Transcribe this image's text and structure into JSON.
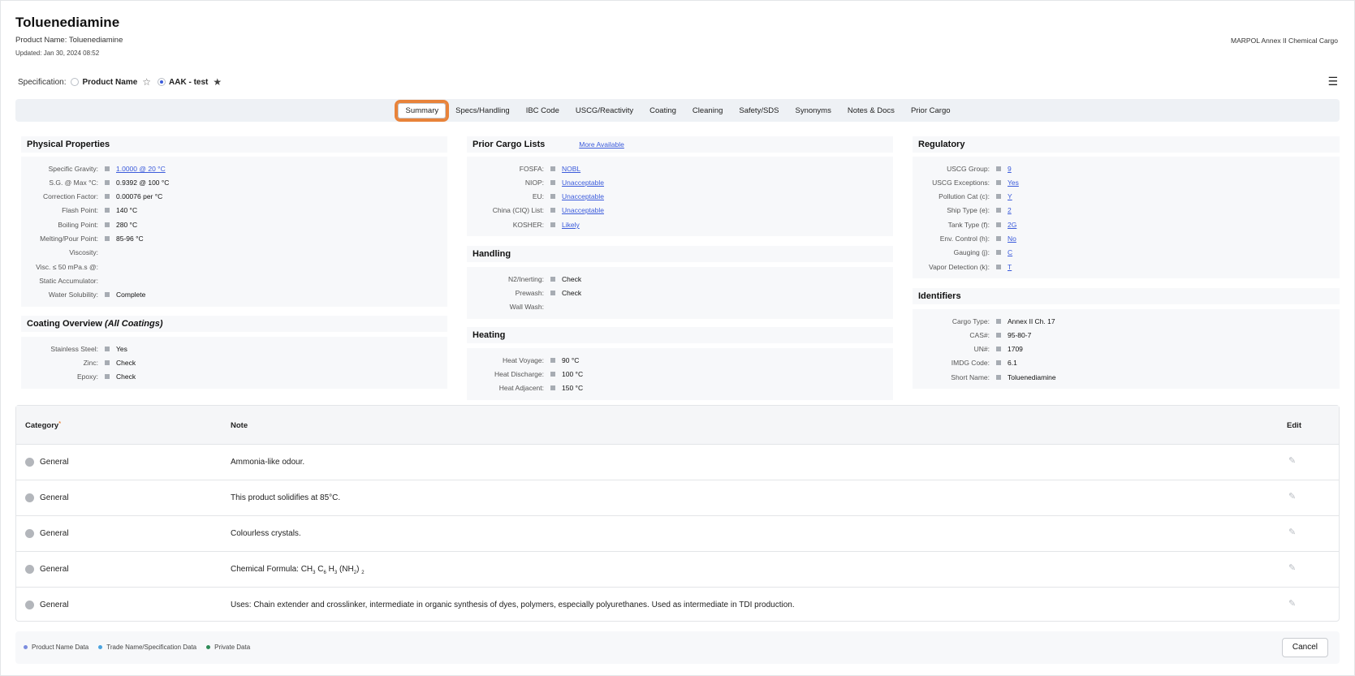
{
  "header": {
    "title": "Toluenediamine",
    "product_name": "Product Name: Toluenediamine",
    "updated": "Updated: Jan 30, 2024 08:52",
    "classification": "MARPOL Annex II Chemical Cargo"
  },
  "specification": {
    "label": "Specification:",
    "options": [
      {
        "label": "Product Name",
        "selected": false,
        "favorite": false
      },
      {
        "label": "AAK - test",
        "selected": true,
        "favorite": true
      }
    ]
  },
  "tabs": [
    {
      "label": "Summary",
      "active": true
    },
    {
      "label": "Specs/Handling"
    },
    {
      "label": "IBC Code"
    },
    {
      "label": "USCG/Reactivity"
    },
    {
      "label": "Coating"
    },
    {
      "label": "Cleaning"
    },
    {
      "label": "Safety/SDS"
    },
    {
      "label": "Synonyms"
    },
    {
      "label": "Notes & Docs"
    },
    {
      "label": "Prior Cargo"
    }
  ],
  "physical": {
    "title": "Physical Properties",
    "rows": [
      {
        "k": "Specific Gravity:",
        "v": "1.0000 @ 20 °C",
        "link": true
      },
      {
        "k": "S.G. @ Max °C:",
        "v": "0.9392 @ 100 °C"
      },
      {
        "k": "Correction Factor:",
        "v": "0.00076 per °C"
      },
      {
        "k": "Flash Point:",
        "v": "140 °C"
      },
      {
        "k": "Boiling Point:",
        "v": "280 °C"
      },
      {
        "k": "Melting/Pour Point:",
        "v": "85-96 °C"
      },
      {
        "k": "Viscosity:",
        "v": ""
      },
      {
        "k": "Visc. ≤ 50 mPa.s @:",
        "v": ""
      },
      {
        "k": "Static Accumulator:",
        "v": ""
      },
      {
        "k": "Water Solubility:",
        "v": "Complete"
      }
    ]
  },
  "coating": {
    "title": "Coating Overview",
    "title_suffix": "(All Coatings)",
    "rows": [
      {
        "k": "Stainless Steel:",
        "v": "Yes"
      },
      {
        "k": "Zinc:",
        "v": "Check"
      },
      {
        "k": "Epoxy:",
        "v": "Check"
      }
    ]
  },
  "prior_cargo": {
    "title": "Prior Cargo Lists",
    "more": "More Available",
    "rows": [
      {
        "k": "FOSFA:",
        "v": "NOBL",
        "link": true
      },
      {
        "k": "NIOP:",
        "v": "Unacceptable",
        "link": true
      },
      {
        "k": "EU:",
        "v": "Unacceptable",
        "link": true
      },
      {
        "k": "China (CIQ) List:",
        "v": "Unacceptable",
        "link": true
      },
      {
        "k": "KOSHER:",
        "v": "Likely",
        "link": true
      }
    ]
  },
  "handling": {
    "title": "Handling",
    "rows": [
      {
        "k": "N2/Inerting:",
        "v": "Check"
      },
      {
        "k": "Prewash:",
        "v": "Check"
      },
      {
        "k": "Wall Wash:",
        "v": ""
      }
    ]
  },
  "heating": {
    "title": "Heating",
    "rows": [
      {
        "k": "Heat Voyage:",
        "v": "90 °C"
      },
      {
        "k": "Heat Discharge:",
        "v": "100 °C"
      },
      {
        "k": "Heat Adjacent:",
        "v": "150 °C"
      }
    ]
  },
  "regulatory": {
    "title": "Regulatory",
    "rows": [
      {
        "k": "USCG Group:",
        "v": "9",
        "link": true
      },
      {
        "k": "USCG Exceptions:",
        "v": "Yes",
        "link": true
      },
      {
        "k": "Pollution Cat (c):",
        "v": "Y",
        "link": true
      },
      {
        "k": "Ship Type (e):",
        "v": "2",
        "link": true
      },
      {
        "k": "Tank Type (f):",
        "v": "2G",
        "link": true
      },
      {
        "k": "Env. Control (h):",
        "v": "No",
        "link": true
      },
      {
        "k": "Gauging (j):",
        "v": "C",
        "link": true
      },
      {
        "k": "Vapor Detection (k):",
        "v": "T",
        "link": true
      }
    ]
  },
  "identifiers": {
    "title": "Identifiers",
    "rows": [
      {
        "k": "Cargo Type:",
        "v": "Annex II Ch. 17"
      },
      {
        "k": "CAS#:",
        "v": "95-80-7"
      },
      {
        "k": "UN#:",
        "v": "1709"
      },
      {
        "k": "IMDG Code:",
        "v": "6.1"
      },
      {
        "k": "Short Name:",
        "v": "Toluenediamine"
      }
    ]
  },
  "notes_table": {
    "headers": {
      "category": "Category",
      "sort_marker": "*",
      "note": "Note",
      "edit": "Edit"
    },
    "rows": [
      {
        "category": "General",
        "note": "Ammonia-like odour."
      },
      {
        "category": "General",
        "note": "This product solidifies at 85°C."
      },
      {
        "category": "General",
        "note": "Colourless crystals."
      },
      {
        "category": "General",
        "note_parts": [
          "Chemical Formula: CH",
          "3",
          " C",
          "6",
          " H",
          "3",
          " (NH",
          "2",
          ") ",
          "2"
        ]
      },
      {
        "category": "General",
        "note": "Uses: Chain extender and crosslinker, intermediate in organic synthesis of dyes, polymers, especially polyurethanes. Used as intermediate in TDI production."
      }
    ]
  },
  "legend": [
    {
      "label": "Product Name Data",
      "color": "#7b8cde"
    },
    {
      "label": "Trade Name/Specification Data",
      "color": "#4aa3df"
    },
    {
      "label": "Private Data",
      "color": "#2e8b57"
    }
  ],
  "footer": {
    "cancel_label": "Cancel"
  }
}
